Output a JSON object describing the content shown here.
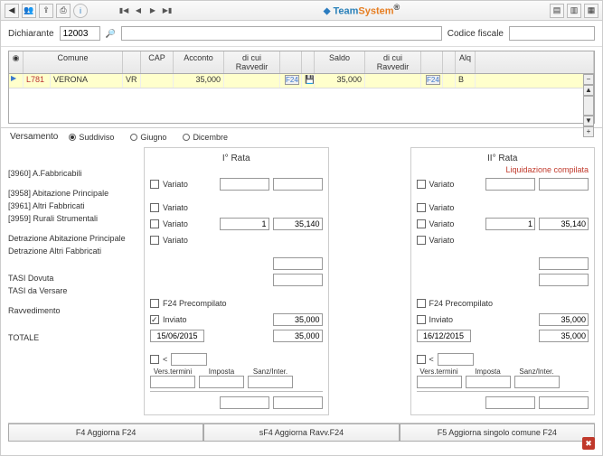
{
  "brand": {
    "t1": "Team",
    "t2": "System",
    "sup": "®"
  },
  "header": {
    "dichiarante_label": "Dichiarante",
    "dichiarante_value": "12003",
    "codice_fiscale_label": "Codice fiscale"
  },
  "grid": {
    "cols": [
      "",
      "Comune",
      "",
      "CAP",
      "Acconto",
      "di cui Ravvedir",
      "",
      "",
      "Saldo",
      "di cui Ravvedir",
      "",
      "",
      "Alq",
      ""
    ],
    "row": {
      "code": "L781",
      "comune": "VERONA",
      "prov": "VR",
      "cap": "",
      "acconto": "35,000",
      "rav1": "",
      "f24a": "F24",
      "saldo": "35,000",
      "rav2": "",
      "f24b": "F24",
      "alq": "B"
    }
  },
  "versamento": {
    "label": "Versamento",
    "opts": [
      "Suddiviso",
      "Giugno",
      "Dicembre"
    ],
    "selected": 0
  },
  "rata_labels": {
    "i": "I° Rata",
    "ii": "II° Rata"
  },
  "liq_note": "Liquidazione compilata",
  "left_rows": {
    "r1": "[3960] A.Fabbricabili",
    "r2": "[3958] Abitazione Principale",
    "r3": "[3961] Altri Fabbricati",
    "r4": "[3959] Rurali Strumentali",
    "det1": "Detrazione Abitazione Principale",
    "det2": "Detrazione Altri Fabbricati",
    "tasi1": "TASI Dovuta",
    "tasi2": "TASI da Versare",
    "rav": "Ravvedimento",
    "tot": "TOTALE"
  },
  "variato": "Variato",
  "f24pre": "F24 Precompilato",
  "inviato": "Inviato",
  "rata1": {
    "altri_q": "1",
    "altri_v": "35,140",
    "dovuta": "35,000",
    "versare": "35,000",
    "date": "15/06/2015"
  },
  "rata2": {
    "altri_q": "1",
    "altri_v": "35,140",
    "dovuta": "35,000",
    "versare": "35,000",
    "date": "16/12/2015"
  },
  "sum_lbls": {
    "lt": "<",
    "vt": "Vers.termini",
    "imp": "Imposta",
    "si": "Sanz/Inter."
  },
  "buttons": {
    "b1": "F4 Aggiorna F24",
    "b2": "sF4 Aggiorna Ravv.F24",
    "b3": "F5 Aggiorna singolo comune F24"
  }
}
